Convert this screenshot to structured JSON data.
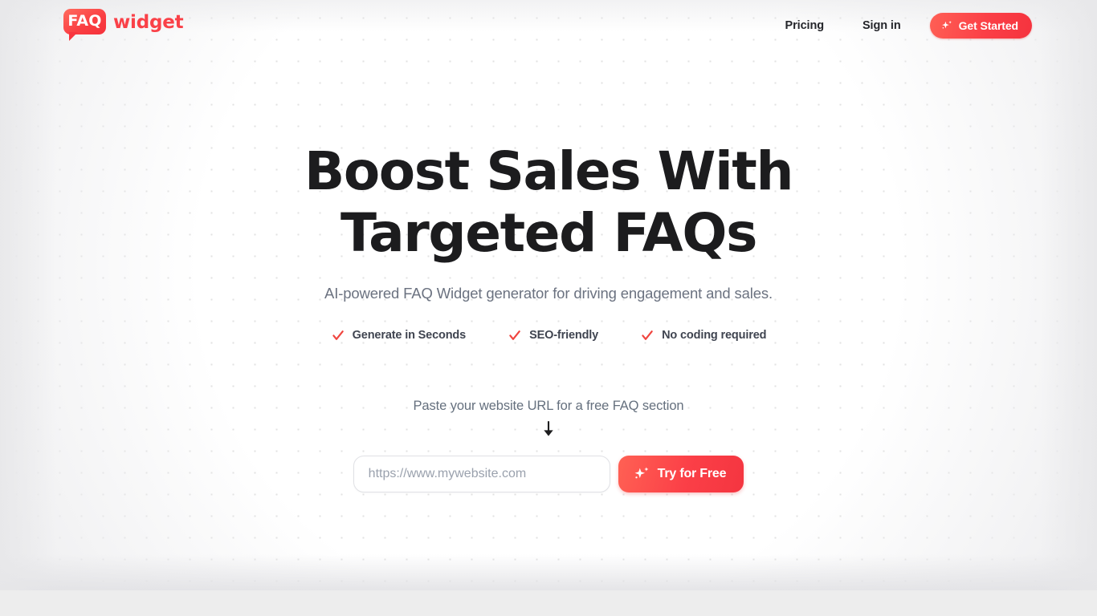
{
  "brand": {
    "badge_text": "FAQ",
    "word_text": "widget",
    "accent_color": "#fa4148",
    "accent_dark": "#f5313b"
  },
  "header": {
    "nav": [
      {
        "label": "Pricing",
        "name": "pricing"
      },
      {
        "label": "Sign in",
        "name": "signin"
      }
    ],
    "cta": {
      "label": "Get Started",
      "icon": "sparkle-icon"
    }
  },
  "hero": {
    "headline_line1": "Boost Sales With",
    "headline_line2": "Targeted FAQs",
    "subheadline": "AI-powered FAQ Widget generator for driving engagement and sales.",
    "features": [
      {
        "label": "Generate in Seconds",
        "icon": "check-icon"
      },
      {
        "label": "SEO-friendly",
        "icon": "check-icon"
      },
      {
        "label": "No coding required",
        "icon": "check-icon"
      }
    ],
    "paste_prompt": "Paste your website URL for a free FAQ section",
    "arrow_icon": "arrow-down-icon",
    "url_field": {
      "value": "",
      "placeholder": "https://www.mywebsite.com"
    },
    "submit": {
      "label": "Try for Free",
      "icon": "sparkle-icon"
    }
  },
  "colors": {
    "text_dark": "#1c1c1e",
    "text_muted": "#6b7280",
    "check_red": "#f0453f",
    "page_bg": "#ededed"
  }
}
